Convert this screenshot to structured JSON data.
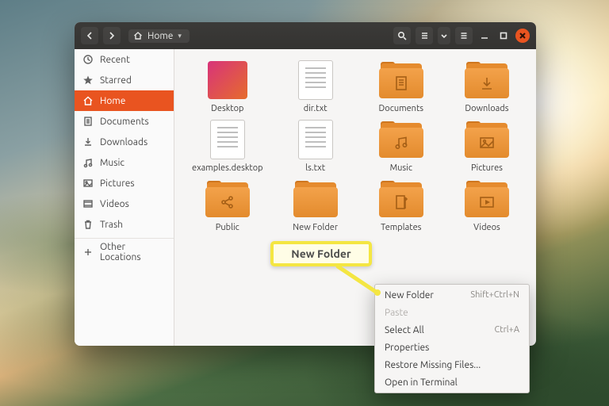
{
  "header": {
    "location_label": "Home"
  },
  "sidebar": {
    "items": [
      {
        "key": "recent",
        "label": "Recent"
      },
      {
        "key": "starred",
        "label": "Starred"
      },
      {
        "key": "home",
        "label": "Home"
      },
      {
        "key": "documents",
        "label": "Documents"
      },
      {
        "key": "downloads",
        "label": "Downloads"
      },
      {
        "key": "music",
        "label": "Music"
      },
      {
        "key": "pictures",
        "label": "Pictures"
      },
      {
        "key": "videos",
        "label": "Videos"
      },
      {
        "key": "trash",
        "label": "Trash"
      },
      {
        "key": "other",
        "label": "Other Locations"
      }
    ],
    "active_key": "home"
  },
  "files": [
    {
      "name": "Desktop",
      "type": "desktop"
    },
    {
      "name": "dir.txt",
      "type": "text"
    },
    {
      "name": "Documents",
      "type": "folder",
      "glyph": "doc"
    },
    {
      "name": "Downloads",
      "type": "folder",
      "glyph": "download"
    },
    {
      "name": "examples.desktop",
      "type": "text"
    },
    {
      "name": "ls.txt",
      "type": "text"
    },
    {
      "name": "Music",
      "type": "folder",
      "glyph": "music"
    },
    {
      "name": "Pictures",
      "type": "folder",
      "glyph": "picture"
    },
    {
      "name": "Public",
      "type": "folder",
      "glyph": "share"
    },
    {
      "name": "New Folder",
      "type": "folder",
      "glyph": ""
    },
    {
      "name": "Templates",
      "type": "folder",
      "glyph": "templates"
    },
    {
      "name": "Videos",
      "type": "folder",
      "glyph": "video"
    }
  ],
  "context_menu": {
    "items": [
      {
        "label": "New Folder",
        "accel": "Shift+Ctrl+N",
        "disabled": false
      },
      {
        "label": "Paste",
        "accel": "",
        "disabled": true
      },
      {
        "label": "Select All",
        "accel": "Ctrl+A",
        "disabled": false
      },
      {
        "label": "Properties",
        "accel": "",
        "disabled": false
      },
      {
        "label": "Restore Missing Files...",
        "accel": "",
        "disabled": false
      },
      {
        "label": "Open in Terminal",
        "accel": "",
        "disabled": false
      }
    ]
  },
  "callout": {
    "text": "New Folder"
  }
}
